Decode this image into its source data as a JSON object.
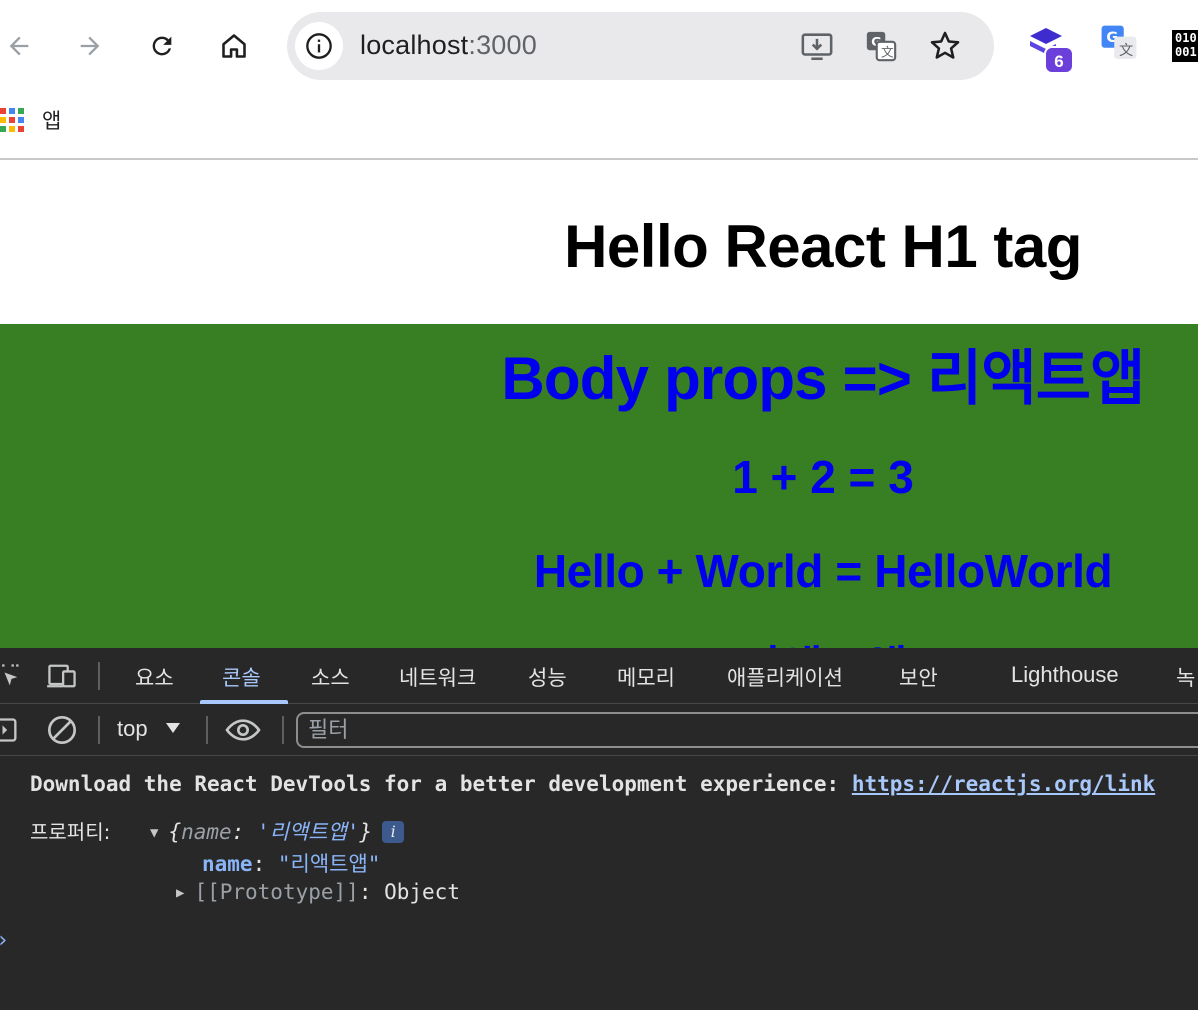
{
  "browser": {
    "url_host": "localhost",
    "url_port": ":3000",
    "extension_badge": "6",
    "ext_binary_top": "010",
    "ext_binary_bottom": "001"
  },
  "bookmarks": {
    "apps_label": "앱"
  },
  "page": {
    "h1": "Hello React H1 tag",
    "body_props": "Body props => 리액트앱",
    "math": "1 + 2 = 3",
    "concat": "Hello + World = HelloWorld",
    "cut_off_line": "리액트앱"
  },
  "colors": {
    "body_bg": "#387e22",
    "body_text": "#0000ee",
    "devtools_bg": "#282828",
    "devtools_accent": "#a8c7fa"
  },
  "devtools": {
    "tabs": [
      "요소",
      "콘솔",
      "소스",
      "네트워크",
      "성능",
      "메모리",
      "애플리케이션",
      "보안",
      "Lighthouse",
      "녹"
    ],
    "active_tab": "콘솔",
    "context": "top",
    "filter_placeholder": "필터",
    "console": {
      "msg_text": "Download the React DevTools for a better development experience: ",
      "msg_link": "https://reactjs.org/link",
      "log_label": "프로퍼티:",
      "obj_open": "{",
      "obj_key": "name",
      "obj_colon": ": ",
      "obj_value": "'리액트앱'",
      "obj_close": "}",
      "info_badge": "i",
      "prop_key": "name",
      "prop_colon": ": ",
      "prop_value": "\"리액트앱\"",
      "proto_key": "[[Prototype]]",
      "proto_colon": ": ",
      "proto_value": "Object",
      "prompt_symbol": "›"
    }
  }
}
